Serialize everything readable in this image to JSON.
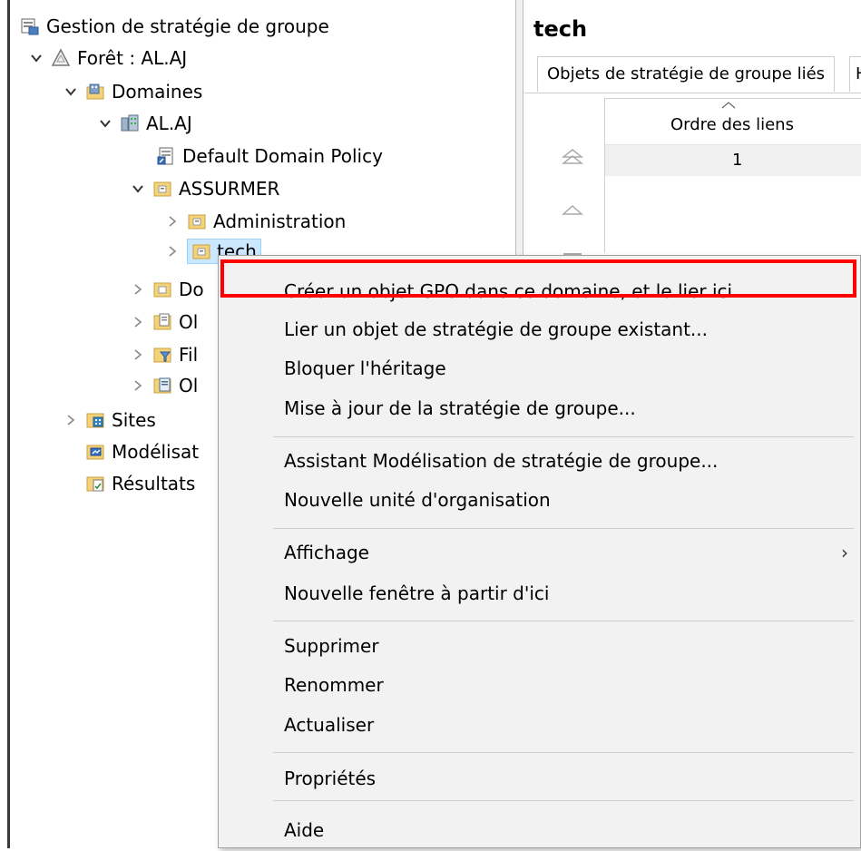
{
  "tree": {
    "root": "Gestion de stratégie de groupe",
    "forest": "Forêt : AL.AJ",
    "domains": "Domaines",
    "domain": "AL.AJ",
    "default_policy": "Default Domain Policy",
    "assurmer": "ASSURMER",
    "administration": "Administration",
    "tech": "tech",
    "partial_do": "Do",
    "partial_o1": "Ol",
    "partial_fi": "Fil",
    "partial_o2": "Ol",
    "sites": "Sites",
    "modelisation": "Modélisat",
    "resultats": "Résultats"
  },
  "right_pane": {
    "title": "tech",
    "tab_active": "Objets de stratégie de groupe liés",
    "tab_next": "H",
    "col_header": "Ordre des liens",
    "row1_order": "1"
  },
  "context_menu": {
    "items": [
      "Créer un objet GPO dans ce domaine, et le lier ici...",
      "Lier un objet de stratégie de groupe existant...",
      "Bloquer l'héritage",
      "Mise à jour de la stratégie de groupe...",
      "Assistant Modélisation de stratégie de groupe...",
      "Nouvelle unité d'organisation",
      "Affichage",
      "Nouvelle fenêtre à partir d'ici",
      "Supprimer",
      "Renommer",
      "Actualiser",
      "Propriétés",
      "Aide"
    ],
    "submenu_arrow": "›"
  },
  "colors": {
    "highlight_box": "#ff0000",
    "selection": "#cce8ff",
    "menu_bg": "#f2f2f2"
  }
}
